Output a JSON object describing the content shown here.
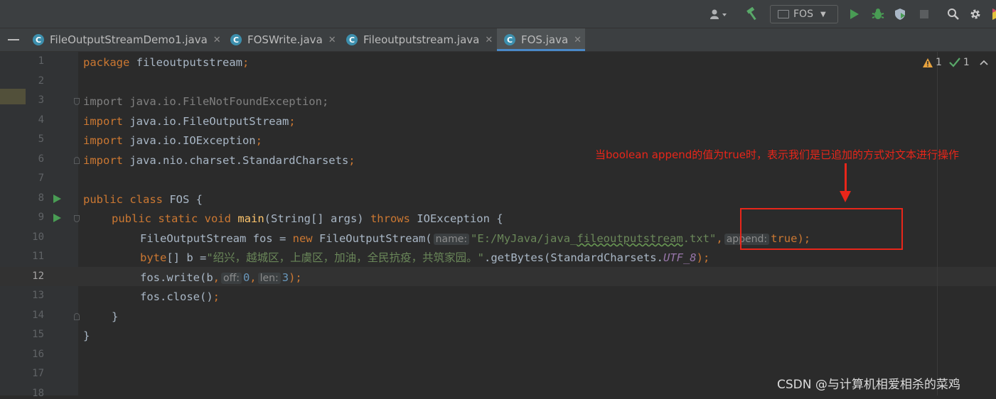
{
  "toolbar": {
    "user_icon": "user-icon",
    "build_icon": "hammer-icon",
    "run_config": "FOS",
    "run_icon": "run-icon",
    "debug_icon": "debug-icon",
    "coverage_icon": "coverage-icon",
    "stop_icon": "stop-icon",
    "search_icon": "search-icon",
    "settings_icon": "gear-icon"
  },
  "tabs": [
    {
      "label": "FileOutputStreamDemo1.java",
      "icon": "C",
      "active": false
    },
    {
      "label": "FOSWrite.java",
      "icon": "C",
      "active": false
    },
    {
      "label": "Fileoutputstream.java",
      "icon": "C",
      "active": false
    },
    {
      "label": "FOS.java",
      "icon": "C",
      "active": true
    }
  ],
  "inspections": {
    "warnings": "1",
    "ok": "1"
  },
  "editor": {
    "current_line": 12,
    "line_numbers": [
      "1",
      "2",
      "3",
      "4",
      "5",
      "6",
      "7",
      "8",
      "9",
      "10",
      "11",
      "12",
      "13",
      "14",
      "15",
      "16",
      "17",
      "18"
    ],
    "code": {
      "l1_kw": "package",
      "l1_name": " fileoutputstream",
      "l1_semi": ";",
      "l3_text": "import java.io.FileNotFoundException;",
      "l4_kw": "import",
      "l4_name": " java.io.FileOutputStream",
      "l4_semi": ";",
      "l5_kw": "import",
      "l5_name": " java.io.IOException",
      "l5_semi": ";",
      "l6_kw": "import",
      "l6_name": " java.nio.charset.StandardCharsets",
      "l6_semi": ";",
      "l8_kw": "public class",
      "l8_rest": " FOS {",
      "l9_kw1": "public static void",
      "l9_fn": "main",
      "l9_mid": "(String[] args) ",
      "l9_kw2": "throws",
      "l9_end": " IOException {",
      "l10_a": "FileOutputStream fos = ",
      "l10_new": "new",
      "l10_b": " FileOutputStream(",
      "l10_hint1": "name:",
      "l10_str_a": "\"E:/MyJava/java_",
      "l10_str_b": "fileoutputstream",
      "l10_str_c": ".txt\"",
      "l10_comma": ",",
      "l10_hint2": "append:",
      "l10_true": "true",
      "l10_end": ");",
      "l11_kw": "byte",
      "l11_a": "[] b =",
      "l11_str": "\"绍兴，越城区，上虞区，加油，全民抗疫，共筑家园。\"",
      "l11_b": ".getBytes(StandardCharsets.",
      "l11_const": "UTF_8",
      "l11_end": ");",
      "l12_a": "fos.write(b",
      "l12_comma1": ",",
      "l12_hint1": "off:",
      "l12_n1": "0",
      "l12_comma2": ",",
      "l12_hint2": "len:",
      "l12_n2": "3",
      "l12_end": ");",
      "l13_a": "fos.close()",
      "l13_semi": ";",
      "l14": "}",
      "l15": "}"
    }
  },
  "annotation": {
    "text": "当boolean append的值为true时，表示我们是已追加的方式对文本进行操作",
    "color": "#e8261a"
  },
  "watermark": "CSDN @与计算机相爱相杀的菜鸡"
}
